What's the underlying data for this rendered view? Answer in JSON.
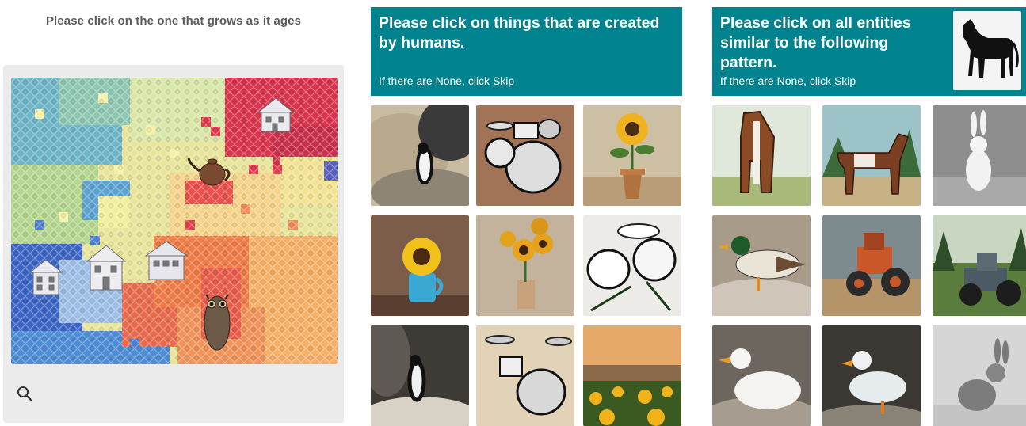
{
  "panel1": {
    "prompt": "Please click on the one that grows as it ages",
    "icons": {
      "search": "magnifier-icon"
    }
  },
  "panel2": {
    "prompt": "Please click on things that are created by humans.",
    "skip_hint": "If there are None, click Skip",
    "header_color": "#00838f"
  },
  "panel3": {
    "prompt": "Please click on all entities similar to the following pattern.",
    "skip_hint": "If there are None, click Skip",
    "header_color": "#00838f"
  }
}
